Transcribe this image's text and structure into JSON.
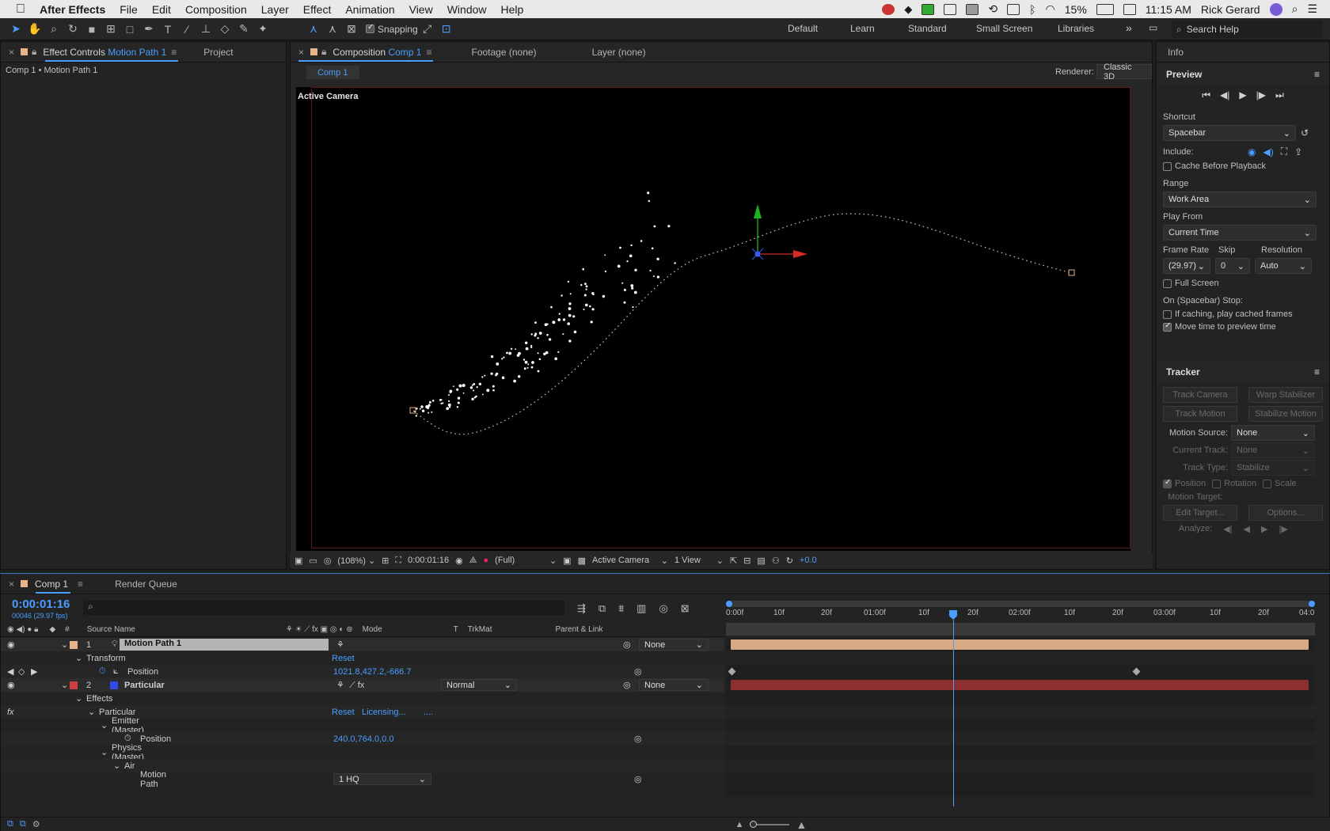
{
  "menubar": {
    "app": "After Effects",
    "items": [
      "File",
      "Edit",
      "Composition",
      "Layer",
      "Effect",
      "Animation",
      "View",
      "Window",
      "Help"
    ],
    "battery": "15%",
    "clock": "11:15 AM",
    "user": "Rick Gerard"
  },
  "toolbar": {
    "snapping": "Snapping",
    "workspaces": [
      "Default",
      "Learn",
      "Standard",
      "Small Screen",
      "Libraries"
    ],
    "search_placeholder": "Search Help"
  },
  "left_panel": {
    "tab_prefix": "Effect Controls",
    "tab_layer": "Motion Path 1",
    "tab_project": "Project",
    "breadcrumb": "Comp 1 • Motion Path 1"
  },
  "comp_panel": {
    "tab_prefix": "Composition",
    "tab_comp": "Comp 1",
    "tab_footage": "Footage (none)",
    "tab_layer": "Layer (none)",
    "subtab": "Comp 1",
    "renderer_label": "Renderer:",
    "renderer_value": "Classic 3D",
    "active_camera": "Active Camera",
    "footer": {
      "zoom": "(108%)",
      "timecode": "0:00:01:16",
      "resolution": "(Full)",
      "camera": "Active Camera",
      "views": "1 View",
      "exposure": "+0.0"
    }
  },
  "info_panel": {
    "title": "Info"
  },
  "preview_panel": {
    "title": "Preview",
    "shortcut_label": "Shortcut",
    "shortcut_value": "Spacebar",
    "include_label": "Include:",
    "cache_before": "Cache Before Playback",
    "range_label": "Range",
    "range_value": "Work Area",
    "play_from_label": "Play From",
    "play_from_value": "Current Time",
    "frame_rate_label": "Frame Rate",
    "skip_label": "Skip",
    "resolution_label": "Resolution",
    "frame_rate_value": "(29.97)",
    "skip_value": "0",
    "resolution_value": "Auto",
    "full_screen": "Full Screen",
    "stop_label": "On (Spacebar) Stop:",
    "if_caching": "If caching, play cached frames",
    "move_time": "Move time to preview time"
  },
  "tracker_panel": {
    "title": "Tracker",
    "track_camera": "Track Camera",
    "warp_stabilizer": "Warp Stabilizer",
    "track_motion": "Track Motion",
    "stabilize_motion": "Stabilize Motion",
    "motion_source_label": "Motion Source:",
    "motion_source_value": "None",
    "current_track_label": "Current Track:",
    "current_track_value": "None",
    "track_type_label": "Track Type:",
    "track_type_value": "Stabilize",
    "position": "Position",
    "rotation": "Rotation",
    "scale": "Scale",
    "motion_target": "Motion Target:",
    "edit_target": "Edit Target...",
    "options": "Options...",
    "analyze": "Analyze:"
  },
  "timeline": {
    "tab_comp": "Comp 1",
    "tab_render": "Render Queue",
    "timecode": "0:00:01:16",
    "frames": "00046 (29.97 fps)",
    "headers": {
      "source": "Source Name",
      "mode": "Mode",
      "t": "T",
      "trkmat": "TrkMat",
      "parent": "Parent & Link"
    },
    "ruler": [
      "0:00f",
      "10f",
      "20f",
      "01:00f",
      "10f",
      "20f",
      "02:00f",
      "10f",
      "20f",
      "03:00f",
      "10f",
      "20f",
      "04:0"
    ],
    "layers": [
      {
        "num": "1",
        "name": "Motion Path 1",
        "parent": "None",
        "color": "#e8b48a"
      },
      {
        "num": "2",
        "name": "Particular",
        "mode": "Normal",
        "parent": "None",
        "color": "#c9403e"
      }
    ],
    "rows": {
      "transform": "Transform",
      "reset": "Reset",
      "position": "Position",
      "position_value": "1021.8,427.2,-666.7",
      "effects": "Effects",
      "particular": "Particular",
      "licensing": "Licensing...",
      "dots": "....",
      "emitter": "Emitter (Master)",
      "emitter_position": "Position",
      "emitter_position_value": "240.0,764.0,0.0",
      "physics": "Physics (Master)",
      "air": "Air",
      "motion_path": "Motion Path",
      "motion_path_value": "1 HQ"
    }
  }
}
